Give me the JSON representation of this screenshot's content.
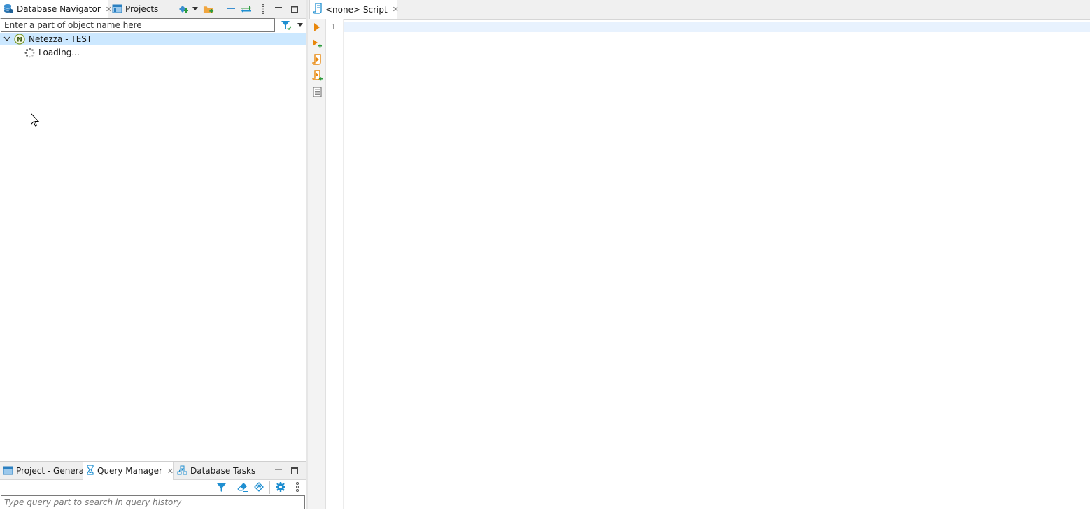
{
  "left_top": {
    "tabs": [
      {
        "label": "Database Navigator",
        "icon": "database-navigator-icon",
        "closable": true,
        "active": true
      },
      {
        "label": "Projects",
        "icon": "projects-icon",
        "closable": false,
        "active": false
      }
    ],
    "filter": {
      "placeholder": "Enter a part of object name here",
      "value": ""
    },
    "tree": [
      {
        "label": "Netezza - TEST",
        "icon": "netezza-connection-icon",
        "expanded": true,
        "selected": true
      },
      {
        "label": "Loading...",
        "icon": "loading-spinner-icon"
      }
    ]
  },
  "left_bottom": {
    "tabs": [
      {
        "label": "Project - General",
        "icon": "project-icon",
        "active": false
      },
      {
        "label": "Query Manager",
        "icon": "query-manager-icon",
        "closable": true,
        "active": true
      },
      {
        "label": "Database Tasks",
        "icon": "database-tasks-icon",
        "active": false
      }
    ],
    "search": {
      "placeholder": "Type query part to search in query history",
      "value": ""
    }
  },
  "editor": {
    "tab": {
      "label": "<none> Script",
      "icon": "sql-script-icon",
      "closable": true
    },
    "line_numbers": [
      "1"
    ],
    "gutter_tools": [
      "execute-statement-icon",
      "execute-in-new-tab-icon",
      "execute-script-icon",
      "execute-script-new-tab-icon",
      "explain-plan-icon"
    ]
  },
  "colors": {
    "accent_blue": "#1f8fd1",
    "orange": "#e8870c",
    "selection": "#cce8ff",
    "netezza_green": "#7c9a2c"
  }
}
